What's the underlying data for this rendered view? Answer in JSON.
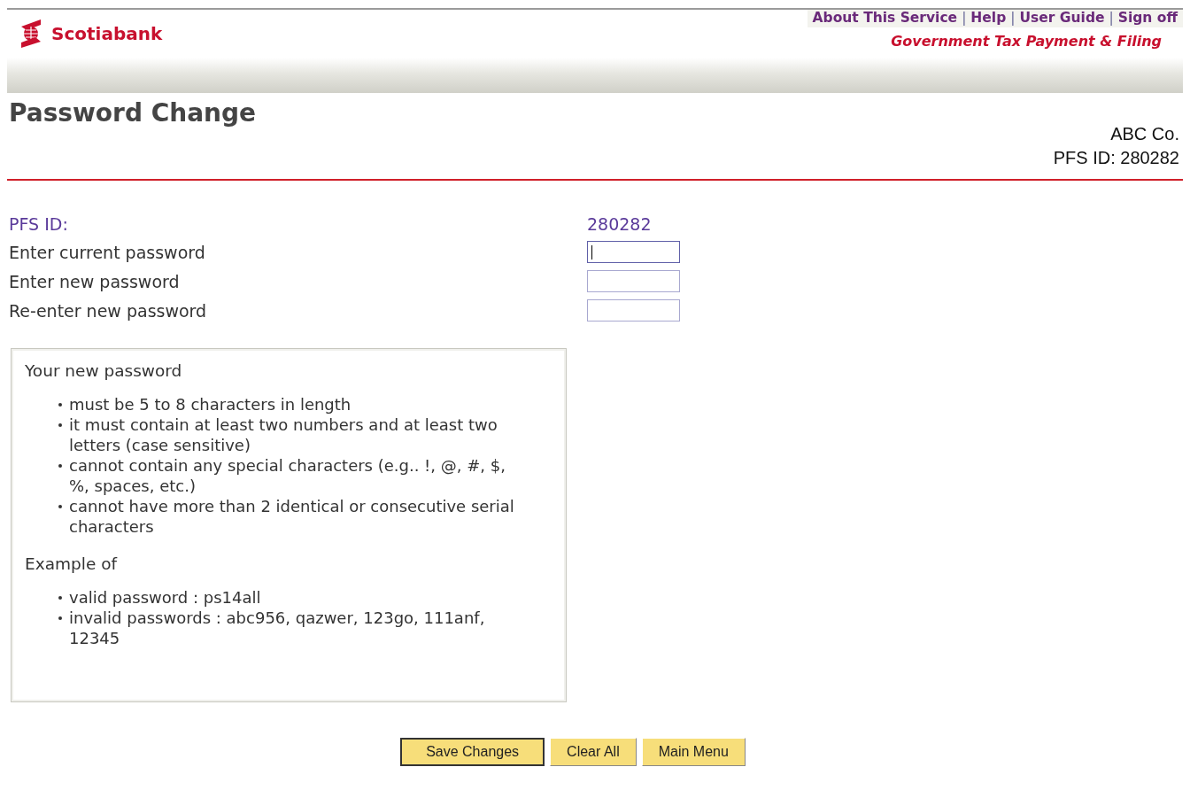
{
  "header": {
    "brand": "Scotiabank",
    "links": [
      {
        "kind": "link",
        "label": "About This Service"
      },
      {
        "kind": "separator",
        "label": "|"
      },
      {
        "kind": "link",
        "label": "Help"
      },
      {
        "kind": "separator",
        "label": "|"
      },
      {
        "kind": "link",
        "label": "User Guide"
      },
      {
        "kind": "separator",
        "label": "|"
      },
      {
        "kind": "link",
        "label": "Sign off"
      }
    ],
    "tagline": "Government Tax Payment & Filing"
  },
  "page_title": "Password Change",
  "account": {
    "company": "ABC Co.",
    "id_line": "PFS ID:  280282"
  },
  "form": {
    "id_label": "PFS ID:",
    "id_value": "280282",
    "fields": [
      {
        "label": "Enter current password",
        "focused": true
      },
      {
        "label": "Enter new password",
        "focused": false
      },
      {
        "label": "Re-enter new password",
        "focused": false
      }
    ]
  },
  "rules": {
    "sections": [
      {
        "heading": "Your new password",
        "items": [
          "must be 5 to 8 characters in length",
          "it must contain at least two numbers and at least two letters (case sensitive)",
          "cannot contain any special characters (e.g.. !, @, #, $, %, spaces, etc.)",
          "cannot have more than 2 identical or consecutive serial characters"
        ]
      },
      {
        "heading": "Example of",
        "items": [
          "valid password : ps14all",
          "invalid passwords : abc956, qazwer, 123go, 111anf, 12345"
        ]
      }
    ]
  },
  "buttons": [
    {
      "label": "Save Changes",
      "default": true
    },
    {
      "label": "Clear All",
      "default": false
    },
    {
      "label": "Main Menu",
      "default": false
    }
  ]
}
